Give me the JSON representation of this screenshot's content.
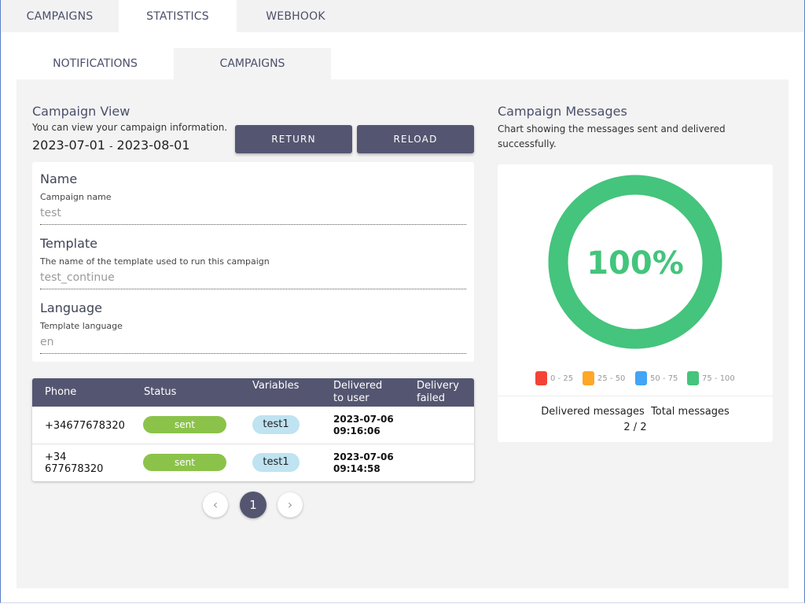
{
  "top_tabs": [
    {
      "label": "CAMPAIGNS",
      "active": false
    },
    {
      "label": "STATISTICS",
      "active": true
    },
    {
      "label": "WEBHOOK",
      "active": false
    }
  ],
  "sub_tabs": [
    {
      "label": "NOTIFICATIONS",
      "active": false
    },
    {
      "label": "CAMPAIGNS",
      "active": true
    }
  ],
  "campaign_view": {
    "title": "Campaign View",
    "description": "You can view your campaign information.",
    "date_start": "2023-07-01",
    "date_sep": "-",
    "date_end": "2023-08-01",
    "return_label": "RETURN",
    "reload_label": "RELOAD"
  },
  "fields": [
    {
      "label": "Name",
      "hint": "Campaign name",
      "value": "test"
    },
    {
      "label": "Template",
      "hint": "The name of the template used to run this campaign",
      "value": "test_continue"
    },
    {
      "label": "Language",
      "hint": "Template language",
      "value": "en"
    }
  ],
  "table": {
    "headers": {
      "phone": "Phone",
      "status": "Status",
      "variables": "Variables",
      "delivered_1": "Delivered",
      "delivered_2": "to user",
      "failed_1": "Delivery",
      "failed_2": "failed"
    },
    "rows": [
      {
        "phone_1": "+34677678320",
        "phone_2": "",
        "status": "sent",
        "variable": "test1",
        "delivered_date": "2023-07-06",
        "delivered_time": "09:16:06",
        "failed": ""
      },
      {
        "phone_1": "+34",
        "phone_2": "677678320",
        "status": "sent",
        "variable": "test1",
        "delivered_date": "2023-07-06",
        "delivered_time": "09:14:58",
        "failed": ""
      }
    ]
  },
  "pagination": {
    "prev": "‹",
    "current": "1",
    "next": "›"
  },
  "messages": {
    "title": "Campaign Messages",
    "description_1": "Chart showing the messages sent and delivered",
    "description_2": "successfully.",
    "percent_label": "100%",
    "legend": [
      {
        "label": "0 - 25",
        "color": "#f44336"
      },
      {
        "label": "25 - 50",
        "color": "#ffa726"
      },
      {
        "label": "50 - 75",
        "color": "#42a5f5"
      },
      {
        "label": "75 - 100",
        "color": "#44c47c"
      }
    ],
    "delivered_label": "Delivered messages",
    "total_label": "Total messages",
    "delivered_value": "2",
    "separator": "/",
    "total_value": "2"
  },
  "chart_data": {
    "type": "pie",
    "values": [
      2,
      0
    ],
    "title": "",
    "ring_color": "#44c47c",
    "track_color": "#e6e6e6"
  }
}
